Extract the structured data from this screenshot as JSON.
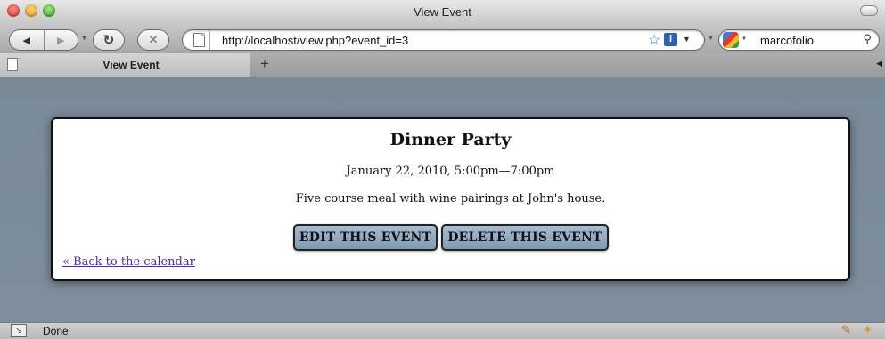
{
  "window": {
    "title": "View Event"
  },
  "toolbar": {
    "back_icon": "back-arrow-icon",
    "forward_icon": "forward-arrow-icon",
    "reload_icon": "reload-icon",
    "stop_icon": "stop-icon",
    "url": "http://localhost/view.php?event_id=3",
    "search_value": "marcofolio"
  },
  "tabs": [
    {
      "label": "View Event",
      "active": true
    }
  ],
  "event": {
    "title": "Dinner Party",
    "time": "January 22, 2010, 5:00pm—7:00pm",
    "description": "Five course meal with wine pairings at John's house.",
    "edit_label": "EDIT THIS EVENT",
    "delete_label": "DELETE THIS EVENT",
    "back_link": "« Back to the calendar"
  },
  "status": {
    "text": "Done"
  },
  "colors": {
    "page_background": "#7b8a99",
    "button_fill": "#8faac4",
    "link": "#4a2aa8"
  }
}
